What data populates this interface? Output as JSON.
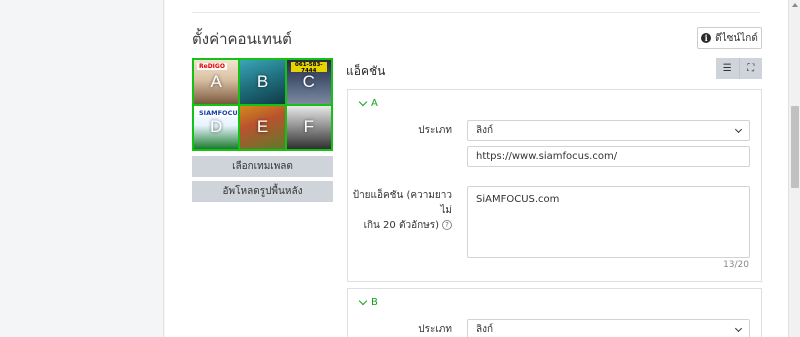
{
  "content_settings": {
    "title": "ตั้งค่าคอนเทนต์",
    "guide_button_label": "ดีไซน์ไกด์",
    "thumbnails": [
      {
        "letter": "A",
        "brand": "ReDIGO"
      },
      {
        "letter": "B",
        "brand": ""
      },
      {
        "letter": "C",
        "brand": "061-583-7444"
      },
      {
        "letter": "D",
        "brand": "SIAMFOCUS"
      },
      {
        "letter": "E",
        "brand": ""
      },
      {
        "letter": "F",
        "brand": ""
      }
    ],
    "select_template_label": "เลือกเทมเพลต",
    "upload_background_label": "อัพโหลดรูปพื้นหลัง"
  },
  "actions": {
    "title": "แอ็คชัน",
    "view_list_icon": "☰",
    "view_expand_icon": "⛶",
    "items": [
      {
        "letter": "A",
        "type_label": "ประเภท",
        "type_value": "ลิงก์",
        "url_value": "https://www.siamfocus.com/",
        "caption_label_line1": "ป้ายแอ็คชัน (ความยาวไม่",
        "caption_label_line2": "เกิน 20 ตัวอักษร)",
        "help_icon": "?",
        "caption_value": "SiAMFOCUS.com",
        "char_count": "13/20"
      },
      {
        "letter": "B",
        "type_label": "ประเภท",
        "type_value": "ลิงก์"
      }
    ]
  },
  "colors": {
    "accent_green": "#13c213",
    "button_gray": "#ced4da"
  }
}
